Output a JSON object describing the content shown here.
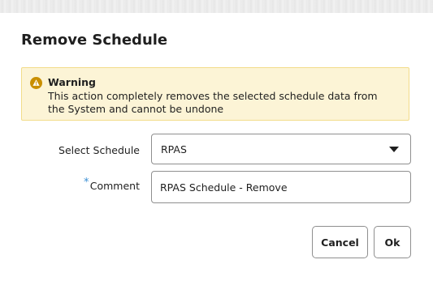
{
  "dialog": {
    "title": "Remove Schedule"
  },
  "warning": {
    "title": "Warning",
    "message": "This action completely removes the selected schedule data from the System and cannot be undone",
    "icon": "warning-triangle-icon",
    "background_color": "#fcf4d6",
    "icon_color": "#c98f00"
  },
  "form": {
    "schedule_label": "Select Schedule",
    "schedule_value": "RPAS",
    "comment_label": "Comment",
    "comment_required_marker": "*",
    "comment_value": "RPAS Schedule - Remove"
  },
  "buttons": {
    "cancel_label": "Cancel",
    "ok_label": "Ok"
  }
}
